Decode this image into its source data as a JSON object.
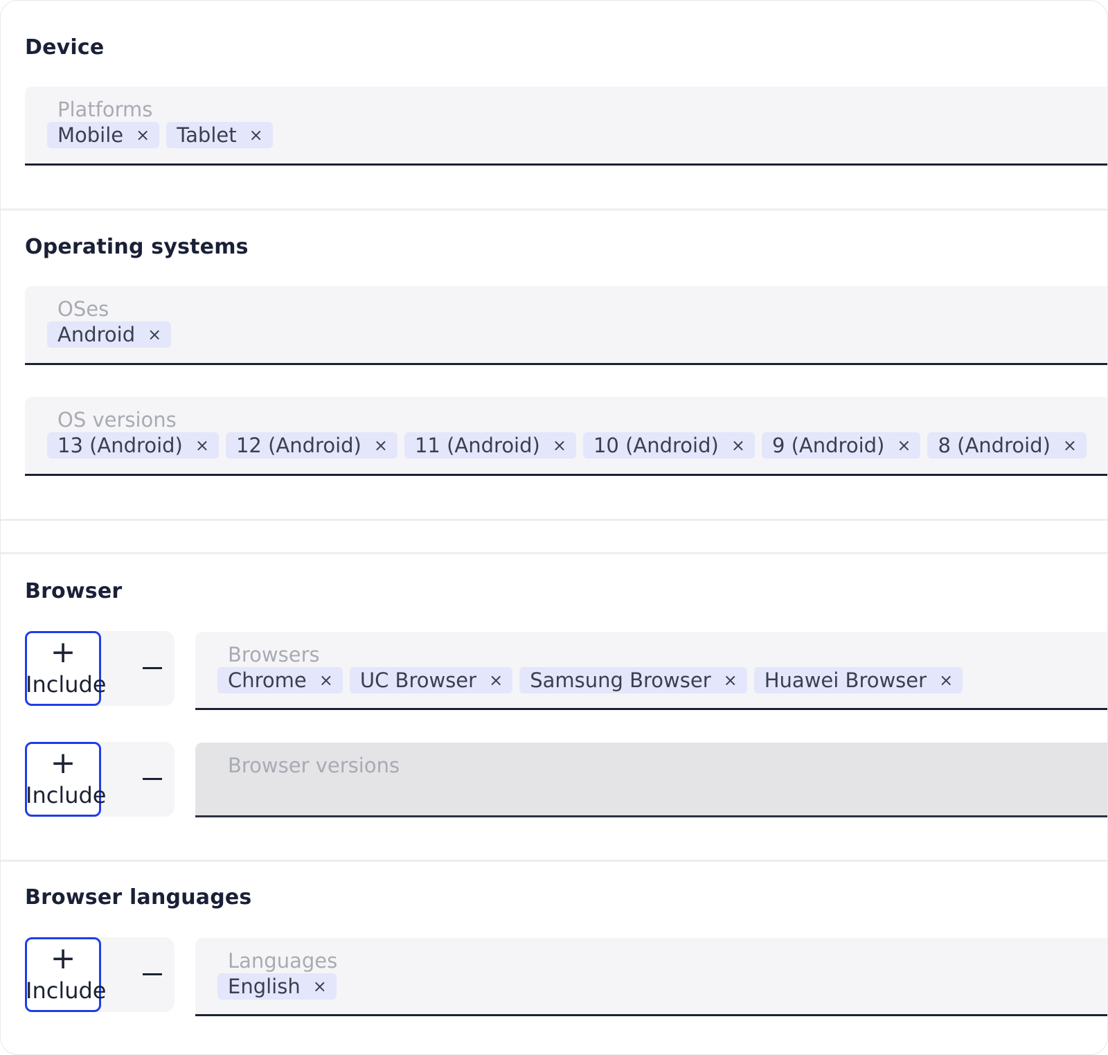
{
  "sections": {
    "device": {
      "title": "Device",
      "platforms": {
        "label": "Platforms",
        "chips": [
          "Mobile",
          "Tablet"
        ]
      }
    },
    "operating_systems": {
      "title": "Operating systems",
      "oses": {
        "label": "OSes",
        "chips": [
          "Android"
        ]
      },
      "os_versions": {
        "label": "OS versions",
        "chips": [
          "13 (Android)",
          "12 (Android)",
          "11 (Android)",
          "10 (Android)",
          "9 (Android)",
          "8 (Android)"
        ]
      }
    },
    "browser": {
      "title": "Browser",
      "browsers": {
        "label": "Browsers",
        "chips": [
          "Chrome",
          "UC Browser",
          "Samsung Browser",
          "Huawei Browser"
        ]
      },
      "browser_versions": {
        "label": "Browser versions",
        "disabled": true
      }
    },
    "browser_languages": {
      "title": "Browser languages",
      "languages": {
        "label": "Languages",
        "chips": [
          "English"
        ]
      }
    }
  },
  "toggle": {
    "plus_icon": "+",
    "include_label": "Include",
    "exclude_icon": "minus-icon"
  },
  "chip_remove_glyph": "×",
  "colors": {
    "accent": "#1f3de6",
    "chip_bg": "#e4e6fb",
    "field_bg": "#f5f5f7",
    "field_disabled_bg": "#e4e4e6"
  }
}
